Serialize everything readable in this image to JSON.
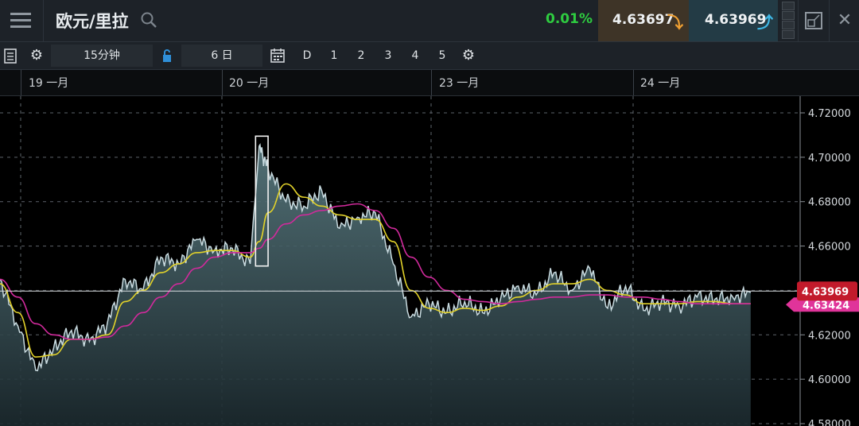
{
  "header": {
    "title": "欧元/里拉",
    "change": "0.01%",
    "sell_price": "4.63697",
    "buy_price": "4.63969",
    "close_symbol": "✕"
  },
  "toolbar": {
    "interval": "15分钟",
    "range": "6 日",
    "buttons": [
      "D",
      "1",
      "2",
      "3",
      "4",
      "5"
    ]
  },
  "colors": {
    "price_line": "#c9dbe0",
    "ma_fast": "#e2d22a",
    "ma_slow": "#d12a9c",
    "price_tag": "#c21a2b",
    "ma_tag": "#e0349a",
    "change_up": "#2ecc40"
  },
  "chart_data": {
    "type": "area",
    "x_labels": [
      "19 一月",
      "20 一月",
      "23 一月",
      "24 一月"
    ],
    "y_ticks": [
      "4.72000",
      "4.70000",
      "4.68000",
      "4.66000",
      "4.64000",
      "4.62000",
      "4.60000",
      "4.58000"
    ],
    "ylim": [
      4.58,
      4.725
    ],
    "current_price": 4.63969,
    "current_price_label": "4.63969",
    "ma_value_label": "4.63424",
    "grid": true,
    "highlight_box": {
      "x_from": 28.6,
      "x_to": 30.0,
      "y_from": 4.651,
      "y_to": 4.7095
    },
    "x": [
      0,
      2,
      4,
      6,
      8,
      10,
      12,
      14,
      16,
      18,
      20,
      22,
      24,
      26,
      28,
      29,
      30,
      32,
      34,
      36,
      38,
      40,
      42,
      44,
      46,
      48,
      50,
      52,
      54,
      56,
      58,
      60,
      62,
      64,
      66,
      68,
      70,
      72,
      74,
      76,
      78,
      80,
      82,
      84
    ],
    "price": [
      4.645,
      4.624,
      4.604,
      4.614,
      4.622,
      4.617,
      4.625,
      4.645,
      4.64,
      4.655,
      4.652,
      4.663,
      4.658,
      4.659,
      4.652,
      4.705,
      4.695,
      4.68,
      4.678,
      4.685,
      4.668,
      4.673,
      4.675,
      4.652,
      4.628,
      4.634,
      4.63,
      4.635,
      4.63,
      4.636,
      4.642,
      4.638,
      4.648,
      4.64,
      4.65,
      4.632,
      4.642,
      4.631,
      4.635,
      4.633,
      4.637,
      4.636,
      4.637,
      4.639
    ],
    "series": [
      {
        "values": [
          4.643,
          4.63,
          4.61,
          4.611,
          4.618,
          4.618,
          4.62,
          4.635,
          4.64,
          4.648,
          4.652,
          4.657,
          4.658,
          4.658,
          4.655,
          4.662,
          4.675,
          4.688,
          4.682,
          4.678,
          4.674,
          4.672,
          4.672,
          4.662,
          4.64,
          4.632,
          4.63,
          4.632,
          4.631,
          4.633,
          4.637,
          4.64,
          4.643,
          4.643,
          4.645,
          4.64,
          4.638,
          4.634,
          4.634,
          4.634,
          4.635,
          4.635,
          4.634,
          4.634
        ]
      },
      {
        "values": [
          4.645,
          4.637,
          4.625,
          4.62,
          4.618,
          4.618,
          4.619,
          4.624,
          4.63,
          4.637,
          4.643,
          4.65,
          4.655,
          4.657,
          4.657,
          4.659,
          4.663,
          4.67,
          4.674,
          4.676,
          4.678,
          4.679,
          4.676,
          4.668,
          4.655,
          4.646,
          4.64,
          4.636,
          4.635,
          4.634,
          4.635,
          4.636,
          4.637,
          4.637,
          4.638,
          4.638,
          4.637,
          4.637,
          4.636,
          4.635,
          4.634,
          4.634,
          4.634,
          4.634
        ]
      }
    ]
  }
}
